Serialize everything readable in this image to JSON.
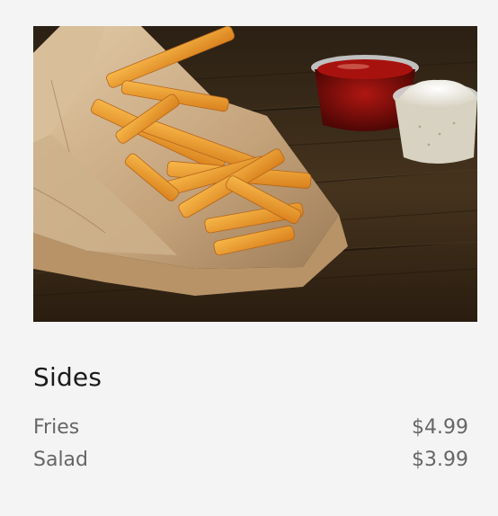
{
  "section": {
    "title": "Sides",
    "image": {
      "icon": "fries-photo-icon",
      "colors": {
        "table": "#3a2a18",
        "paper": "#c9ab86",
        "fries": "#f0a131",
        "ketchup": "#8a0f0c",
        "dip": "#eeeadd"
      }
    },
    "items": [
      {
        "name": "Fries",
        "price": "$4.99"
      },
      {
        "name": "Salad",
        "price": "$3.99"
      }
    ]
  }
}
